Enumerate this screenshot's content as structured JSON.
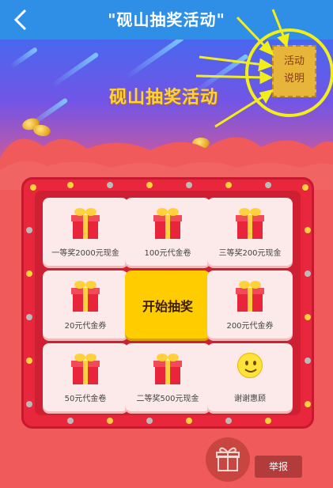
{
  "header": {
    "title": "\"砚山抽奖活动\""
  },
  "banner": {
    "title": "砚山抽奖活动"
  },
  "rules": {
    "line1": "活动",
    "line2": "说明"
  },
  "prizes": [
    {
      "label": "一等奖2000元现金",
      "icon": "gift-icon"
    },
    {
      "label": "100元代金卷",
      "icon": "gift-icon"
    },
    {
      "label": "三等奖200元现金",
      "icon": "gift-icon"
    },
    {
      "label": "20元代金券",
      "icon": "gift-icon"
    },
    {
      "label": "开始抽奖",
      "icon": ""
    },
    {
      "label": "200元代金券",
      "icon": "gift-icon"
    },
    {
      "label": "50元代金卷",
      "icon": "gift-icon"
    },
    {
      "label": "二等奖500元现金",
      "icon": "gift-icon"
    },
    {
      "label": "谢谢惠顾",
      "icon": "smiley-icon"
    }
  ],
  "footer": {
    "report_label": "举报"
  },
  "colors": {
    "header": "#2f8fe6",
    "board": "#e8263c",
    "start": "#ffcc00",
    "annotation": "#f2ee1a"
  }
}
